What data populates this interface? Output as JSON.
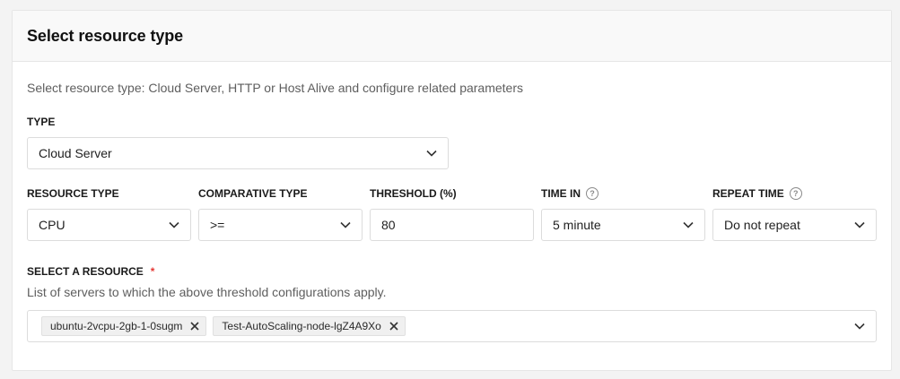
{
  "header": {
    "title": "Select resource type"
  },
  "description": "Select resource type: Cloud Server, HTTP or Host Alive and configure related parameters",
  "type": {
    "label": "TYPE",
    "value": "Cloud Server"
  },
  "resource_type": {
    "label": "RESOURCE TYPE",
    "value": "CPU"
  },
  "comparative_type": {
    "label": "COMPARATIVE TYPE",
    "value": ">="
  },
  "threshold": {
    "label": "THRESHOLD (%)",
    "value": "80"
  },
  "time_in": {
    "label": "TIME IN",
    "value": "5 minute",
    "help_icon": "?"
  },
  "repeat_time": {
    "label": "REPEAT TIME",
    "value": "Do not repeat",
    "help_icon": "?"
  },
  "select_resource": {
    "label": "SELECT A RESOURCE",
    "required_mark": "*",
    "help": "List of servers to which the above threshold configurations apply.",
    "tags": [
      "ubuntu-2vcpu-2gb-1-0sugm",
      "Test-AutoScaling-node-lgZ4A9Xo"
    ]
  },
  "icons": {
    "dropdown": "chevron-down-icon",
    "remove": "close-icon",
    "help": "question-circle-icon"
  },
  "colors": {
    "required": "#e53935",
    "border": "#dcdcdc",
    "tag_bg": "#f0f0f0"
  }
}
